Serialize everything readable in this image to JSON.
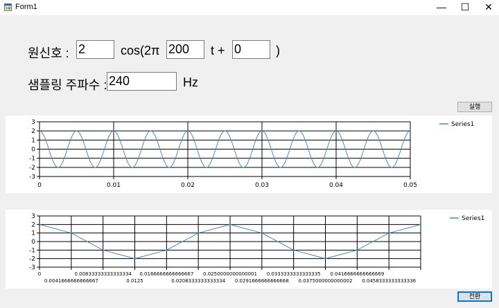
{
  "window": {
    "title": "Form1",
    "minimize": "—",
    "maximize": "☐",
    "close": "✕"
  },
  "form": {
    "signal_label": "원신호 :",
    "amplitude": "2",
    "cos_label": "cos(2π",
    "frequency": "200",
    "t_plus_label": "t +",
    "phase": "0",
    "close_paren": ")",
    "sampling_label": "샘플링 주파수 :",
    "sampling_freq": "240",
    "hz_label": "Hz",
    "run_button": "실행",
    "bottom_button": "전환"
  },
  "colors": {
    "series": "#4a86c8",
    "grid": "#000000"
  },
  "chart_data": [
    {
      "type": "line",
      "series": [
        {
          "name": "Series1",
          "function": "2cos(2π·200·t)"
        }
      ],
      "ylim": [
        -3,
        3
      ],
      "xlim": [
        0,
        0.05
      ],
      "y_ticks": [
        "3",
        "2",
        "1",
        "0",
        "-1",
        "-2",
        "-3"
      ],
      "x_ticks": [
        "0",
        "0.01",
        "0.02",
        "0.03",
        "0.04",
        "0.05"
      ],
      "legend": "top-right",
      "grid": true
    },
    {
      "type": "line",
      "series": [
        {
          "name": "Series1",
          "x": [
            0,
            0.0041666666666667,
            0.00833333333333334,
            0.0125,
            0.0166666666666667,
            0.0208333333333334,
            0.0250000000000001,
            0.0291666666666668,
            0.0333333333333335,
            0.0375000000000002,
            0.0416666666666669,
            0.0458333333333336,
            0.05
          ],
          "values": [
            2,
            1,
            -1,
            -2,
            -1,
            1,
            2,
            1,
            -1,
            -2,
            -1,
            1,
            2
          ]
        }
      ],
      "ylim": [
        -3,
        3
      ],
      "y_ticks": [
        "3",
        "2",
        "1",
        "0",
        "-1",
        "-2",
        "-3"
      ],
      "x_tick_labels_row1": [
        "0",
        "0.00833333333333334",
        "0.0166666666666667",
        "0.0250000000000001",
        "0.0333333333333335",
        "0.0416666666666669"
      ],
      "x_tick_labels_row2": [
        "0.0041666666666667",
        "0.0125",
        "0.0208333333333334",
        "0.0291666666666668",
        "0.0375000000000002",
        "0.0458333333333336"
      ],
      "legend": "top-right",
      "grid": true
    }
  ]
}
